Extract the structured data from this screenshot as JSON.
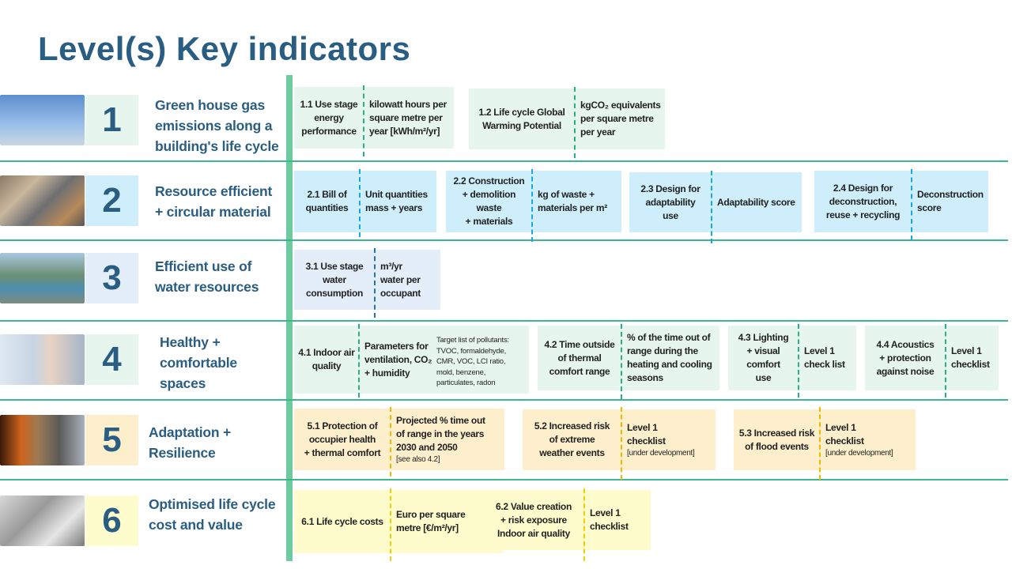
{
  "title": "Level(s) Key indicators",
  "rows": [
    {
      "number": "1",
      "title": "Green house gas\nemissions along a\nbuilding's life cycle",
      "image": "co2-chimney-image",
      "card_color": "#e6f6ef",
      "divider_color": "#2bb07f",
      "cards": [
        {
          "label": "1.1 Use stage\nenergy\nperformance",
          "metric": "kilowatt hours per\nsquare metre per\nyear  [kWh/m²/yr]"
        },
        {
          "label": "1.2 Life cycle Global\nWarming Potential",
          "metric": "kgCO₂ equivalents\nper square metre\nper year"
        }
      ]
    },
    {
      "number": "2",
      "title": "Resource efficient\n+ circular material",
      "image": "materials-collage-image",
      "card_color": "#cdeefa",
      "divider_color": "#1aa7e6",
      "cards": [
        {
          "label": "2.1 Bill of\nquantities",
          "metric": "Unit quantities\nmass + years"
        },
        {
          "label": "2.2 Construction\n+ demolition\nwaste\n+ materials",
          "metric": "kg of waste +\nmaterials per m²"
        },
        {
          "label": "2.3 Design for\nadaptability\nuse",
          "metric": "Adaptability score"
        },
        {
          "label": "2.4 Design for\ndeconstruction,\nreuse + recycling",
          "metric": "Deconstruction\nscore"
        }
      ]
    },
    {
      "number": "3",
      "title": "Efficient use of\nwater resources",
      "image": "dam-image",
      "card_color": "#e3eef8",
      "divider_color": "#2471b5",
      "cards": [
        {
          "label": "3.1 Use stage\nwater\nconsumption",
          "metric": "m³/yr\nwater per\noccupant"
        }
      ]
    },
    {
      "number": "4",
      "title": "Healthy +\ncomfortable\nspaces",
      "image": "stressed-office-worker-image",
      "card_color": "#e6f6ef",
      "divider_color": "#2bb07f",
      "cards": [
        {
          "label": "4.1 Indoor air\nquality",
          "metric": "Parameters for\nventilation, CO₂\n+ humidity",
          "extra": "Target list of pollutants:\nTVOC, formaldehyde,\nCMR, VOC, LCI ratio,\nmold, benzene,\nparticulates,  radon"
        },
        {
          "label": "4.2 Time outside\nof thermal\ncomfort range",
          "metric": "% of the time out of\nrange during the\nheating and cooling\nseasons"
        },
        {
          "label": "4.3 Lighting\n+ visual\ncomfort\nuse",
          "metric": "Level 1\ncheck list"
        },
        {
          "label": "4.4 Acoustics\n+ protection\nagainst noise",
          "metric": "Level 1\nchecklist"
        }
      ]
    },
    {
      "number": "5",
      "title": "Adaptation +\nResilience",
      "image": "climate-extremes-image",
      "card_color": "#fdefcc",
      "divider_color": "#f5b800",
      "cards": [
        {
          "label": "5.1 Protection  of\noccupier health\n+ thermal comfort",
          "metric": "Projected  % time out\nof range in the years\n2030  and 2050",
          "note": "[see also 4.2]"
        },
        {
          "label": "5.2 Increased risk\nof extreme\nweather events",
          "metric": "Level 1\nchecklist",
          "note": "[under development]"
        },
        {
          "label": "5.3 Increased risk\nof flood events",
          "metric": "Level 1\nchecklist",
          "note": "[under development]"
        }
      ]
    },
    {
      "number": "6",
      "title": "Optimised life cycle\ncost and value",
      "image": "calculator-plans-image",
      "card_color": "#fefccc",
      "divider_color": "#f0d000",
      "cards": [
        {
          "label": "6.1 Life cycle costs",
          "metric": "Euro per square\nmetre  [€/m²/yr]"
        },
        {
          "label": "6.2 Value creation\n+ risk exposure\nIndoor air quality",
          "metric": "Level 1\nchecklist"
        }
      ]
    }
  ]
}
